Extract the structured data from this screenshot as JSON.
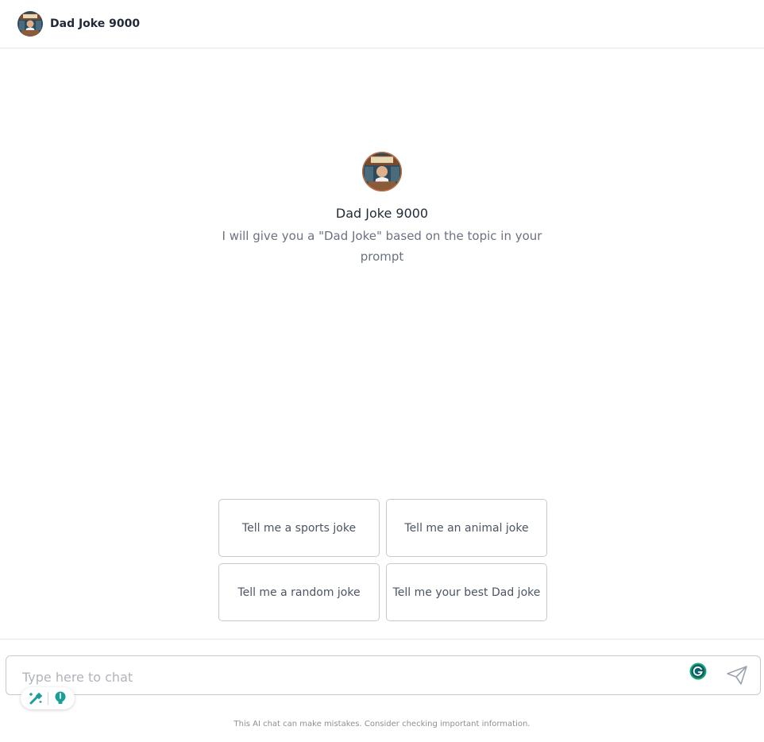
{
  "header": {
    "title": "Dad Joke 9000"
  },
  "hero": {
    "title": "Dad Joke 9000",
    "description": "I will give you a \"Dad Joke\" based on the topic in your prompt"
  },
  "suggestions": [
    {
      "label": "Tell me a sports joke"
    },
    {
      "label": "Tell me an animal joke"
    },
    {
      "label": "Tell me a random joke"
    },
    {
      "label": "Tell me your best Dad joke"
    }
  ],
  "chat": {
    "placeholder": "Type here to chat"
  },
  "footer": {
    "disclaimer": "This AI chat can make mistakes. Consider checking important information."
  },
  "colors": {
    "accent": "#1a9e9a",
    "avatar_bg": "#2d4a5c"
  },
  "icons": {
    "grammarly": "grammarly-icon",
    "send": "send-icon",
    "magic": "magic-wand-icon",
    "idea": "lightbulb-icon"
  }
}
